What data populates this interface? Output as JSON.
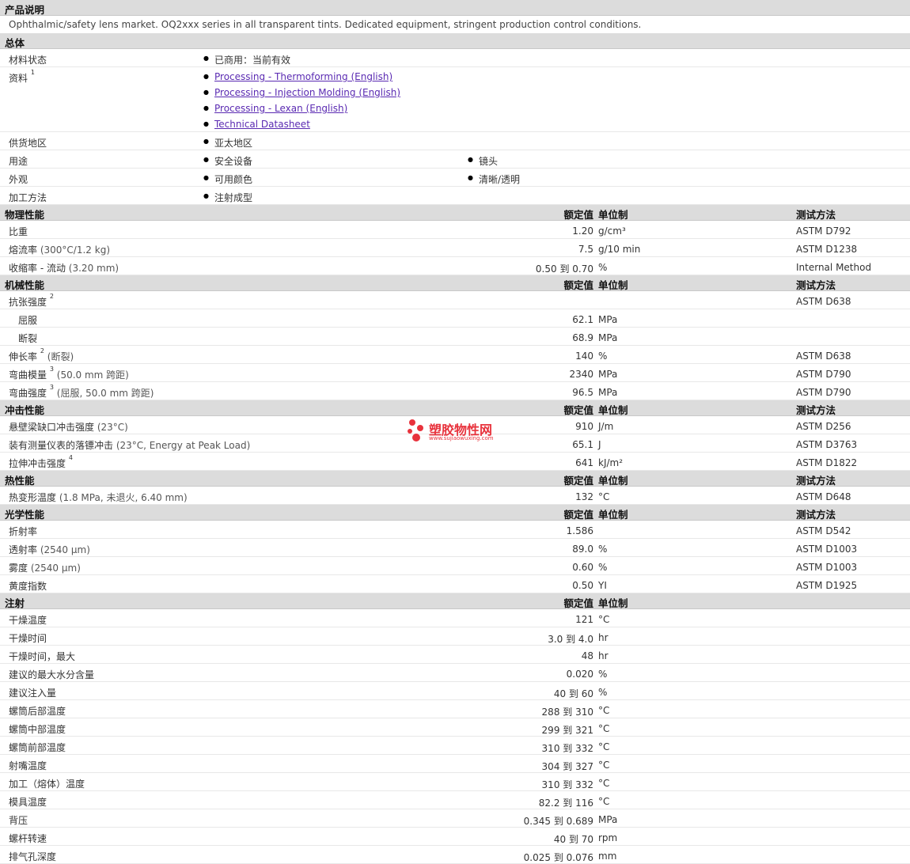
{
  "product_desc": {
    "title": "产品说明",
    "text": "Ophthalmic/safety lens market. OQ2xxx series in all transparent tints. Dedicated equipment, stringent production control conditions."
  },
  "general": {
    "title": "总体",
    "rows": [
      {
        "label": "材料状态",
        "items": [
          "已商用：当前有效"
        ]
      },
      {
        "label": "资料",
        "sup": "1",
        "links": [
          "Processing - Thermoforming (English)",
          "Processing - Injection Molding (English)",
          "Processing - Lexan (English)",
          "Technical Datasheet"
        ]
      },
      {
        "label": "供货地区",
        "items": [
          "亚太地区"
        ]
      },
      {
        "label": "用途",
        "items": [
          "安全设备",
          "镜头"
        ]
      },
      {
        "label": "外观",
        "items": [
          "可用颜色",
          "清晰/透明"
        ]
      },
      {
        "label": "加工方法",
        "items": [
          "注射成型"
        ]
      }
    ]
  },
  "headers": {
    "rated": "额定值",
    "unit": "单位制",
    "test": "测试方法"
  },
  "sections": [
    {
      "title": "物理性能",
      "rows": [
        {
          "name": "比重",
          "param": "",
          "val": "1.20",
          "unit": "g/cm³",
          "test": "ASTM D792"
        },
        {
          "name": "熔流率",
          "param": "(300°C/1.2 kg)",
          "val": "7.5",
          "unit": "g/10 min",
          "test": "ASTM D1238"
        },
        {
          "name": "收缩率 - 流动",
          "param": "(3.20 mm)",
          "val": "0.50 到 0.70",
          "unit": "%",
          "test": "Internal Method"
        }
      ]
    },
    {
      "title": "机械性能",
      "rows": [
        {
          "name": "抗张强度",
          "sup": "2",
          "param": "",
          "val": "",
          "unit": "",
          "test": "ASTM D638"
        },
        {
          "name": "屈服",
          "sub": true,
          "param": "",
          "val": "62.1",
          "unit": "MPa",
          "test": ""
        },
        {
          "name": "断裂",
          "sub": true,
          "param": "",
          "val": "68.9",
          "unit": "MPa",
          "test": ""
        },
        {
          "name": "伸长率",
          "sup": "2",
          "param": "(断裂)",
          "val": "140",
          "unit": "%",
          "test": "ASTM D638"
        },
        {
          "name": "弯曲模量",
          "sup": "3",
          "param": "(50.0 mm 跨距)",
          "val": "2340",
          "unit": "MPa",
          "test": "ASTM D790"
        },
        {
          "name": "弯曲强度",
          "sup": "3",
          "param": "(屈服, 50.0 mm 跨距)",
          "val": "96.5",
          "unit": "MPa",
          "test": "ASTM D790"
        }
      ]
    },
    {
      "title": "冲击性能",
      "rows": [
        {
          "name": "悬壁梁缺口冲击强度",
          "param": "(23°C)",
          "val": "910",
          "unit": "J/m",
          "test": "ASTM D256"
        },
        {
          "name": "装有测量仪表的落镖冲击",
          "param": "(23°C, Energy at Peak Load)",
          "val": "65.1",
          "unit": "J",
          "test": "ASTM D3763"
        },
        {
          "name": "拉伸冲击强度",
          "sup": "4",
          "param": "",
          "val": "641",
          "unit": "kJ/m²",
          "test": "ASTM D1822"
        }
      ]
    },
    {
      "title": "热性能",
      "rows": [
        {
          "name": "热变形温度",
          "param": "(1.8 MPa, 未退火, 6.40 mm)",
          "val": "132",
          "unit": "°C",
          "test": "ASTM D648"
        }
      ]
    },
    {
      "title": "光学性能",
      "rows": [
        {
          "name": "折射率",
          "param": "",
          "val": "1.586",
          "unit": "",
          "test": "ASTM D542"
        },
        {
          "name": "透射率",
          "param": "(2540 µm)",
          "val": "89.0",
          "unit": "%",
          "test": "ASTM D1003"
        },
        {
          "name": "雾度",
          "param": "(2540 µm)",
          "val": "0.60",
          "unit": "%",
          "test": "ASTM D1003"
        },
        {
          "name": "黄度指数",
          "param": "",
          "val": "0.50",
          "unit": "YI",
          "test": "ASTM D1925"
        }
      ]
    },
    {
      "title": "注射",
      "no_test": true,
      "rows": [
        {
          "name": "干燥温度",
          "param": "",
          "val": "121",
          "unit": "°C",
          "test": ""
        },
        {
          "name": "干燥时间",
          "param": "",
          "val": "3.0 到 4.0",
          "unit": "hr",
          "test": ""
        },
        {
          "name": "干燥时间，最大",
          "param": "",
          "val": "48",
          "unit": "hr",
          "test": ""
        },
        {
          "name": "建议的最大水分含量",
          "param": "",
          "val": "0.020",
          "unit": "%",
          "test": ""
        },
        {
          "name": "建议注入量",
          "param": "",
          "val": "40 到 60",
          "unit": "%",
          "test": ""
        },
        {
          "name": "螺筒后部温度",
          "param": "",
          "val": "288 到 310",
          "unit": "°C",
          "test": ""
        },
        {
          "name": "螺筒中部温度",
          "param": "",
          "val": "299 到 321",
          "unit": "°C",
          "test": ""
        },
        {
          "name": "螺筒前部温度",
          "param": "",
          "val": "310 到 332",
          "unit": "°C",
          "test": ""
        },
        {
          "name": "射嘴温度",
          "param": "",
          "val": "304 到 327",
          "unit": "°C",
          "test": ""
        },
        {
          "name": "加工（熔体）温度",
          "param": "",
          "val": "310 到 332",
          "unit": "°C",
          "test": ""
        },
        {
          "name": "模具温度",
          "param": "",
          "val": "82.2 到 116",
          "unit": "°C",
          "test": ""
        },
        {
          "name": "背压",
          "param": "",
          "val": "0.345 到 0.689",
          "unit": "MPa",
          "test": ""
        },
        {
          "name": "螺杆转速",
          "param": "",
          "val": "40 到 70",
          "unit": "rpm",
          "test": ""
        },
        {
          "name": "排气孔深度",
          "param": "",
          "val": "0.025 到 0.076",
          "unit": "mm",
          "test": ""
        }
      ]
    }
  ],
  "watermark": {
    "text": "塑胶物性网",
    "url": "www.sujiaowuxing.com",
    "color": "#e8323c"
  }
}
